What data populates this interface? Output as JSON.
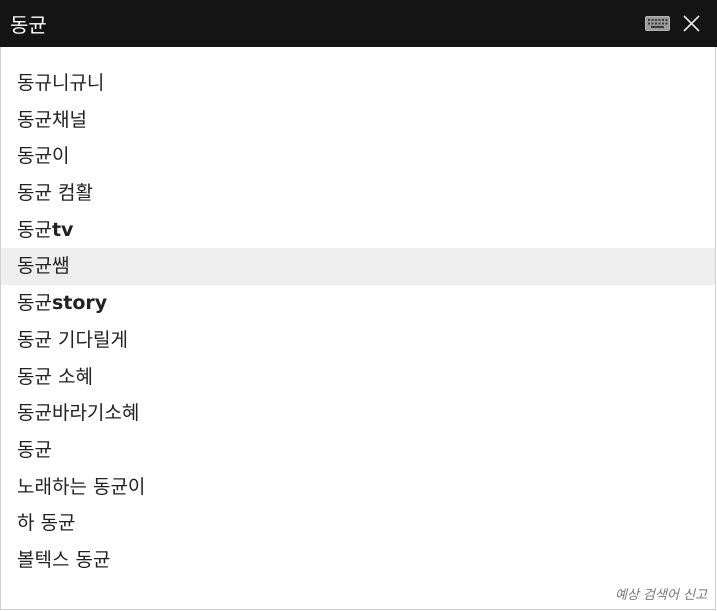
{
  "search": {
    "value": "동균",
    "keyboard_icon": "keyboard-icon",
    "close_icon": "close-icon"
  },
  "suggestions": [
    {
      "prefix": "동규니규니",
      "suffix": "",
      "highlighted": false
    },
    {
      "prefix": "동균채널",
      "suffix": "",
      "highlighted": false
    },
    {
      "prefix": "동균이",
      "suffix": "",
      "highlighted": false
    },
    {
      "prefix": "동균 컴활",
      "suffix": "",
      "highlighted": false
    },
    {
      "prefix": "동균",
      "suffix": "tv",
      "highlighted": false
    },
    {
      "prefix": "동균쌤",
      "suffix": "",
      "highlighted": true
    },
    {
      "prefix": "동균",
      "suffix": "story",
      "highlighted": false
    },
    {
      "prefix": "동균 기다릴게",
      "suffix": "",
      "highlighted": false
    },
    {
      "prefix": "동균 소혜",
      "suffix": "",
      "highlighted": false
    },
    {
      "prefix": "동균바라기소혜",
      "suffix": "",
      "highlighted": false
    },
    {
      "prefix": "동균",
      "suffix": "",
      "highlighted": false
    },
    {
      "prefix": "노래하는 동균이",
      "suffix": "",
      "highlighted": false
    },
    {
      "prefix": "하 동균",
      "suffix": "",
      "highlighted": false
    },
    {
      "prefix": "볼텍스 동균",
      "suffix": "",
      "highlighted": false
    }
  ],
  "footer": {
    "report_label": "예상 검색어 신고"
  },
  "colors": {
    "bar_background": "#141414",
    "highlight_background": "#eeeeee",
    "text": "#222222"
  }
}
